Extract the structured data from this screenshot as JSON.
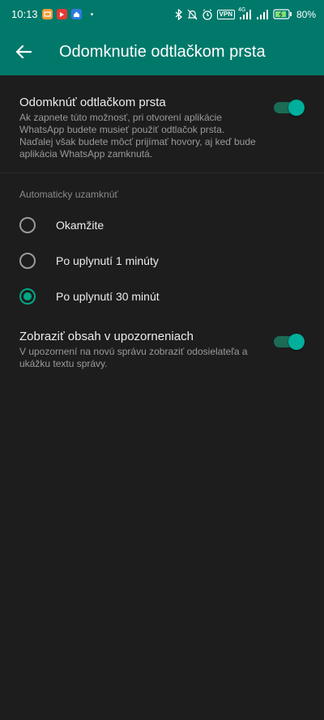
{
  "status_bar": {
    "time": "10:13",
    "battery": "80%",
    "vpn": "VPN",
    "network_4g": "4G",
    "left_icons": [
      "app-notification-icon",
      "youtube-icon",
      "home-app-icon",
      "dot-icon"
    ],
    "right_icons": [
      "bluetooth-icon",
      "mute-icon",
      "alarm-icon",
      "vpn-icon",
      "signal-icon",
      "signal-icon",
      "battery-icon"
    ]
  },
  "app_bar": {
    "title": "Odomknutie odtlačkom prsta",
    "back_icon": "arrow-back-icon"
  },
  "fingerprint_setting": {
    "title": "Odomknúť odtlačkom prsta",
    "description": "Ak zapnete túto možnosť, pri otvorení aplikácie WhatsApp budete musieť použiť odtlačok prsta. Naďalej však budete môcť prijímať hovory, aj keď bude aplikácia WhatsApp zamknutá.",
    "enabled": true
  },
  "auto_lock": {
    "label": "Automaticky uzamknúť",
    "options": [
      {
        "label": "Okamžite",
        "selected": false
      },
      {
        "label": "Po uplynutí 1 minúty",
        "selected": false
      },
      {
        "label": "Po uplynutí 30 minút",
        "selected": true
      }
    ]
  },
  "notification_setting": {
    "title": "Zobraziť obsah v upozorneniach",
    "description": "V upozornení na novú správu zobraziť odosielateľa a ukážku textu správy.",
    "enabled": true
  },
  "colors": {
    "accent": "#00a884",
    "app_bar": "#00796b",
    "background": "#1d1d1d"
  }
}
